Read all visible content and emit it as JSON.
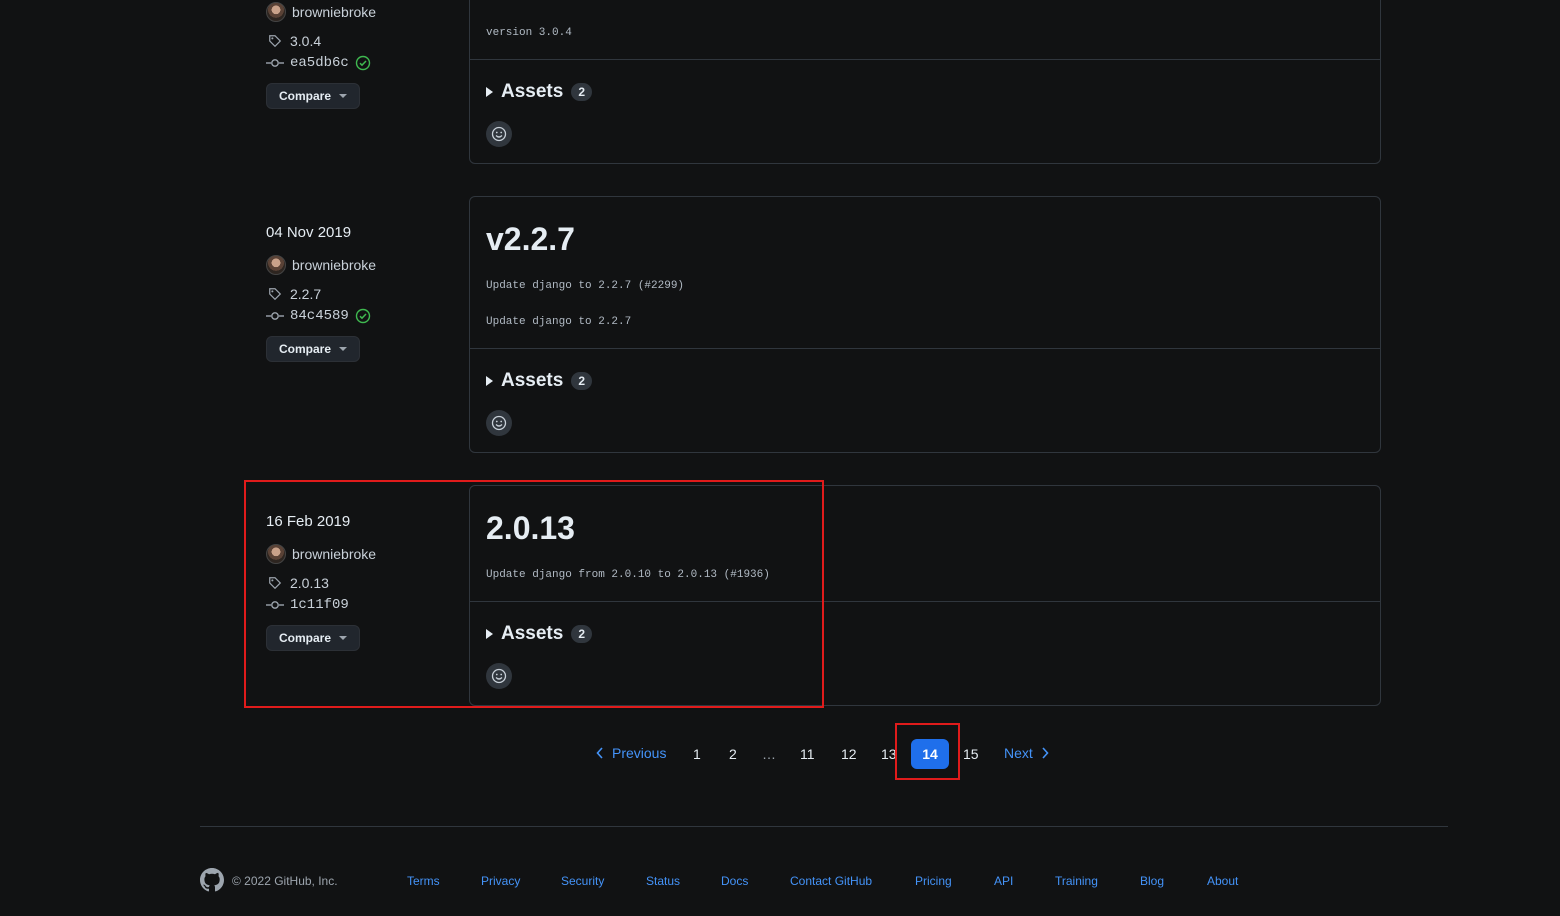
{
  "releases": [
    {
      "date": "",
      "author": "browniebroke",
      "tag": "3.0.4",
      "commit": "ea5db6c",
      "verified": true,
      "compare_label": "Compare",
      "title": "",
      "body": [
        "version 3.0.4"
      ],
      "assets_label": "Assets",
      "assets_count": "2"
    },
    {
      "date": "04 Nov 2019",
      "author": "browniebroke",
      "tag": "2.2.7",
      "commit": "84c4589",
      "verified": true,
      "compare_label": "Compare",
      "title": "v2.2.7",
      "body": [
        "Update django to 2.2.7 (#2299)",
        "Update django to 2.2.7"
      ],
      "assets_label": "Assets",
      "assets_count": "2"
    },
    {
      "date": "16 Feb 2019",
      "author": "browniebroke",
      "tag": "2.0.13",
      "commit": "1c11f09",
      "verified": false,
      "compare_label": "Compare",
      "title": "2.0.13",
      "body": [
        "Update django from 2.0.10 to 2.0.13 (#1936)"
      ],
      "assets_label": "Assets",
      "assets_count": "2"
    }
  ],
  "pagination": {
    "previous": "Previous",
    "next": "Next",
    "pages": [
      "1",
      "2",
      "…",
      "11",
      "12",
      "13"
    ],
    "current": "14",
    "after": [
      "15"
    ]
  },
  "footer": {
    "copyright": "© 2022 GitHub, Inc.",
    "links": [
      "Terms",
      "Privacy",
      "Security",
      "Status",
      "Docs",
      "Contact GitHub",
      "Pricing",
      "API",
      "Training",
      "Blog",
      "About"
    ]
  },
  "colors": {
    "background": "#111213",
    "link": "#4493f8",
    "current_page": "#1f6feb",
    "highlight": "#e01b1b",
    "verified": "#3fb950"
  }
}
